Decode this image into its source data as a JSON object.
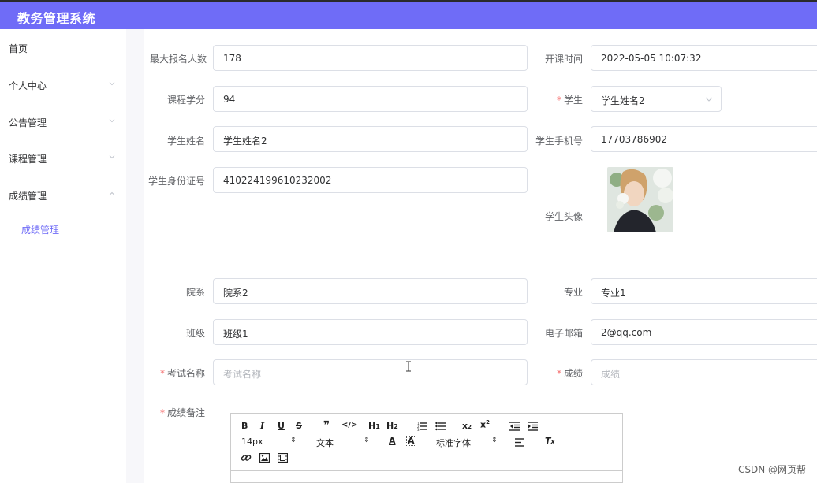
{
  "app": {
    "title": "教务管理系统"
  },
  "sidebar": {
    "items": [
      {
        "label": "首页"
      },
      {
        "label": "个人中心"
      },
      {
        "label": "公告管理"
      },
      {
        "label": "课程管理"
      },
      {
        "label": "成绩管理"
      }
    ],
    "subitems": [
      {
        "label": "成绩管理"
      }
    ]
  },
  "form": {
    "max_enroll": {
      "label": "最大报名人数",
      "value": "178"
    },
    "start_time": {
      "label": "开课时间",
      "value": "2022-05-05 10:07:32"
    },
    "credits": {
      "label": "课程学分",
      "value": "94"
    },
    "student": {
      "label": "学生",
      "value": "学生姓名2"
    },
    "student_name": {
      "label": "学生姓名",
      "value": "学生姓名2"
    },
    "student_phone": {
      "label": "学生手机号",
      "value": "17703786902"
    },
    "student_id_card": {
      "label": "学生身份证号",
      "value": "410224199610232002"
    },
    "student_avatar": {
      "label": "学生头像"
    },
    "department": {
      "label": "院系",
      "value": "院系2"
    },
    "major": {
      "label": "专业",
      "value": "专业1"
    },
    "class": {
      "label": "班级",
      "value": "班级1"
    },
    "email": {
      "label": "电子邮箱",
      "value": "2@qq.com"
    },
    "exam_name": {
      "label": "考试名称",
      "value": "",
      "placeholder": "考试名称"
    },
    "score": {
      "label": "成绩",
      "value": "",
      "placeholder": "成绩"
    },
    "score_note": {
      "label": "成绩备注"
    },
    "required_mark": "*"
  },
  "editor": {
    "font_size": "14px",
    "block_format": "文本",
    "font_family": "标准字体",
    "icons": [
      "bold-icon",
      "italic-icon",
      "underline-icon",
      "strikethrough-icon",
      "blockquote-icon",
      "code-block-icon",
      "heading1-icon",
      "heading2-icon",
      "ordered-list-icon",
      "bullet-list-icon",
      "subscript-icon",
      "superscript-icon",
      "outdent-icon",
      "indent-icon",
      "font-color-icon",
      "background-color-icon",
      "align-icon",
      "clear-format-icon",
      "link-icon",
      "image-icon",
      "video-icon"
    ]
  },
  "watermark": "CSDN @网页帮",
  "colors": {
    "accent": "#6f6cf7",
    "required": "#f56c6c"
  }
}
